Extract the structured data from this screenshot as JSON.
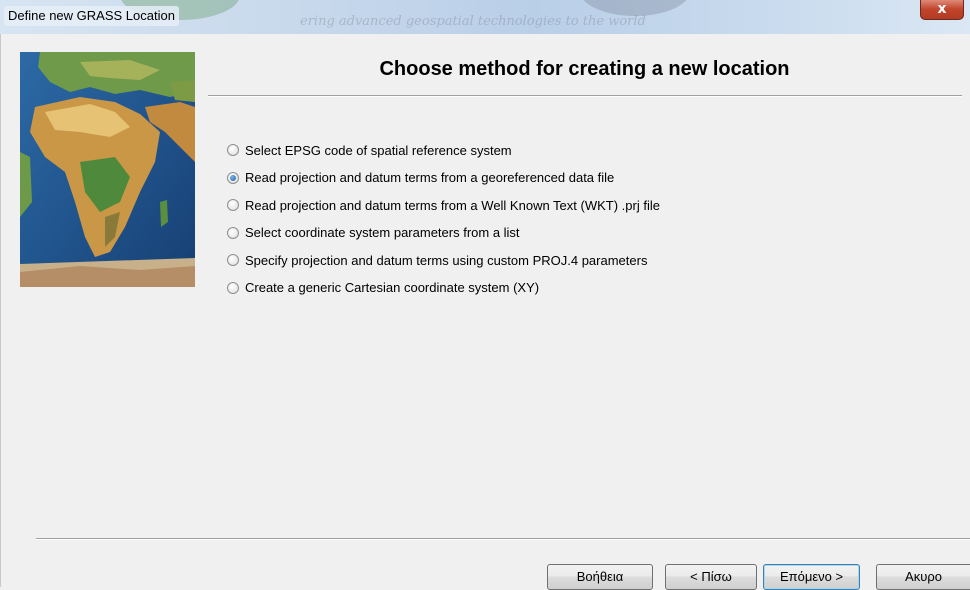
{
  "window": {
    "title": "Define new GRASS Location",
    "close_label": "x",
    "background_text": "ering advanced geospatial technologies to the world"
  },
  "heading": "Choose method for creating a new location",
  "options": [
    {
      "label": "Select EPSG code of spatial reference system",
      "checked": false
    },
    {
      "label": "Read projection and datum terms from a georeferenced data file",
      "checked": true
    },
    {
      "label": "Read projection and datum terms from a Well Known Text (WKT) .prj file",
      "checked": false
    },
    {
      "label": "Select coordinate system parameters from a list",
      "checked": false
    },
    {
      "label": "Specify projection and datum terms using custom PROJ.4 parameters",
      "checked": false
    },
    {
      "label": "Create a generic Cartesian coordinate system (XY)",
      "checked": false
    }
  ],
  "buttons": {
    "help": "Βοήθεια",
    "back": "< Πίσω",
    "next": "Επόμενο >",
    "cancel": "Ακυρο"
  }
}
